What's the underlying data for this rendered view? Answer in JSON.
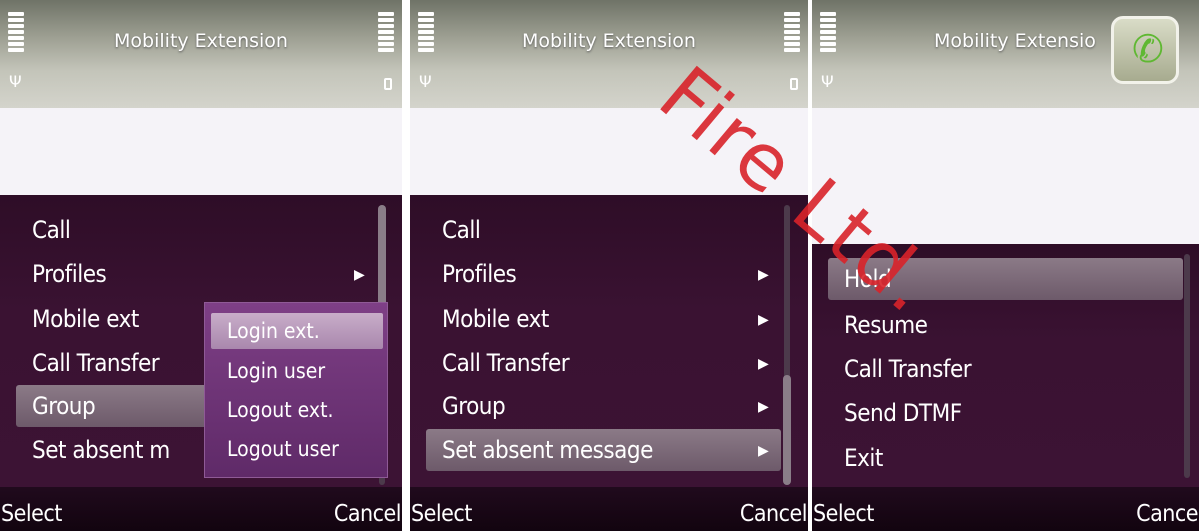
{
  "screens": [
    {
      "title": "Mobility Extension",
      "menu": [
        {
          "label": "Call",
          "submenu": false
        },
        {
          "label": "Profiles",
          "submenu": true
        },
        {
          "label": "Mobile ext",
          "submenu": false
        },
        {
          "label": "Call Transfer",
          "submenu": false
        },
        {
          "label": "Group",
          "submenu": false,
          "selected": true
        },
        {
          "label": "Set absent m",
          "submenu": false
        }
      ],
      "popup": [
        "Login ext.",
        "Login user",
        "Logout ext.",
        "Logout user"
      ],
      "popup_selected": "Login ext.",
      "softkeys": {
        "left": "Select",
        "right": "Cancel"
      }
    },
    {
      "title": "Mobility Extension",
      "menu": [
        {
          "label": "Call",
          "submenu": false
        },
        {
          "label": "Profiles",
          "submenu": true
        },
        {
          "label": "Mobile ext",
          "submenu": true
        },
        {
          "label": "Call Transfer",
          "submenu": true
        },
        {
          "label": "Group",
          "submenu": true
        },
        {
          "label": "Set absent message",
          "submenu": true,
          "selected": true
        }
      ],
      "softkeys": {
        "left": "Select",
        "right": "Cancel"
      }
    },
    {
      "title": "Mobility Extensio",
      "menu": [
        {
          "label": "Hold",
          "selected": true
        },
        {
          "label": "Resume"
        },
        {
          "label": "Call Transfer"
        },
        {
          "label": "Send DTMF"
        },
        {
          "label": "Exit"
        }
      ],
      "softkeys": {
        "left": "Select",
        "right": "Cance"
      }
    }
  ],
  "watermark": "Fire Ltd.",
  "icons": {
    "signal": "signal-bars-icon",
    "battery": "battery-icon",
    "antenna": "antenna-icon",
    "call": "call-handset-icon"
  },
  "colors": {
    "menu_bg": "#3a1232",
    "popup_bg": "#6f3478",
    "header": "#a3a597",
    "watermark": "#d9232a"
  }
}
